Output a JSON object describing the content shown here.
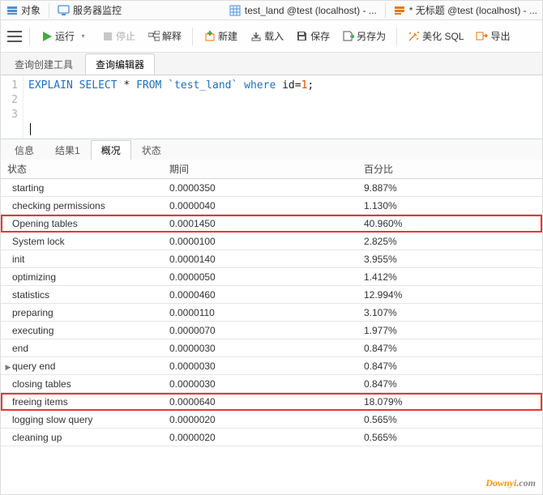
{
  "top_strip": {
    "objects": "对象",
    "server_monitor": "服务器监控",
    "tab1": "test_land @test (localhost) - ...",
    "tab2": "* 无标题 @test (localhost) - ..."
  },
  "toolbar": {
    "run": "运行",
    "stop": "停止",
    "explain": "解释",
    "new": "新建",
    "load": "载入",
    "save": "保存",
    "save_as": "另存为",
    "beautify_sql": "美化 SQL",
    "export": "导出"
  },
  "subtabs": {
    "query_builder": "查询创建工具",
    "query_editor": "查询编辑器"
  },
  "editor": {
    "lines": [
      "1",
      "2",
      "3"
    ],
    "code_explain": "EXPLAIN",
    "code_select": "SELECT",
    "code_star": "*",
    "code_from": "FROM",
    "code_table": "`test_land`",
    "code_where": "where",
    "code_id": "id=",
    "code_val": "1",
    "code_semi": ";"
  },
  "result_tabs": {
    "info": "信息",
    "result1": "结果1",
    "profile": "概况",
    "status": "状态"
  },
  "grid": {
    "columns": {
      "status": "状态",
      "duration": "期间",
      "percent": "百分比"
    },
    "rows": [
      {
        "status": "starting",
        "duration": "0.0000350",
        "percent": "9.887%",
        "hl": false,
        "expand": false
      },
      {
        "status": "checking permissions",
        "duration": "0.0000040",
        "percent": "1.130%",
        "hl": false,
        "expand": false
      },
      {
        "status": "Opening tables",
        "duration": "0.0001450",
        "percent": "40.960%",
        "hl": true,
        "expand": false
      },
      {
        "status": "System lock",
        "duration": "0.0000100",
        "percent": "2.825%",
        "hl": false,
        "expand": false
      },
      {
        "status": "init",
        "duration": "0.0000140",
        "percent": "3.955%",
        "hl": false,
        "expand": false
      },
      {
        "status": "optimizing",
        "duration": "0.0000050",
        "percent": "1.412%",
        "hl": false,
        "expand": false
      },
      {
        "status": "statistics",
        "duration": "0.0000460",
        "percent": "12.994%",
        "hl": false,
        "expand": false
      },
      {
        "status": "preparing",
        "duration": "0.0000110",
        "percent": "3.107%",
        "hl": false,
        "expand": false
      },
      {
        "status": "executing",
        "duration": "0.0000070",
        "percent": "1.977%",
        "hl": false,
        "expand": false
      },
      {
        "status": "end",
        "duration": "0.0000030",
        "percent": "0.847%",
        "hl": false,
        "expand": false
      },
      {
        "status": "query end",
        "duration": "0.0000030",
        "percent": "0.847%",
        "hl": false,
        "expand": true
      },
      {
        "status": "closing tables",
        "duration": "0.0000030",
        "percent": "0.847%",
        "hl": false,
        "expand": false
      },
      {
        "status": "freeing items",
        "duration": "0.0000640",
        "percent": "18.079%",
        "hl": true,
        "expand": false
      },
      {
        "status": "logging slow query",
        "duration": "0.0000020",
        "percent": "0.565%",
        "hl": false,
        "expand": false
      },
      {
        "status": "cleaning up",
        "duration": "0.0000020",
        "percent": "0.565%",
        "hl": false,
        "expand": false
      }
    ]
  },
  "watermark": {
    "a": "Down",
    "b": "yi",
    "c": ".com"
  }
}
